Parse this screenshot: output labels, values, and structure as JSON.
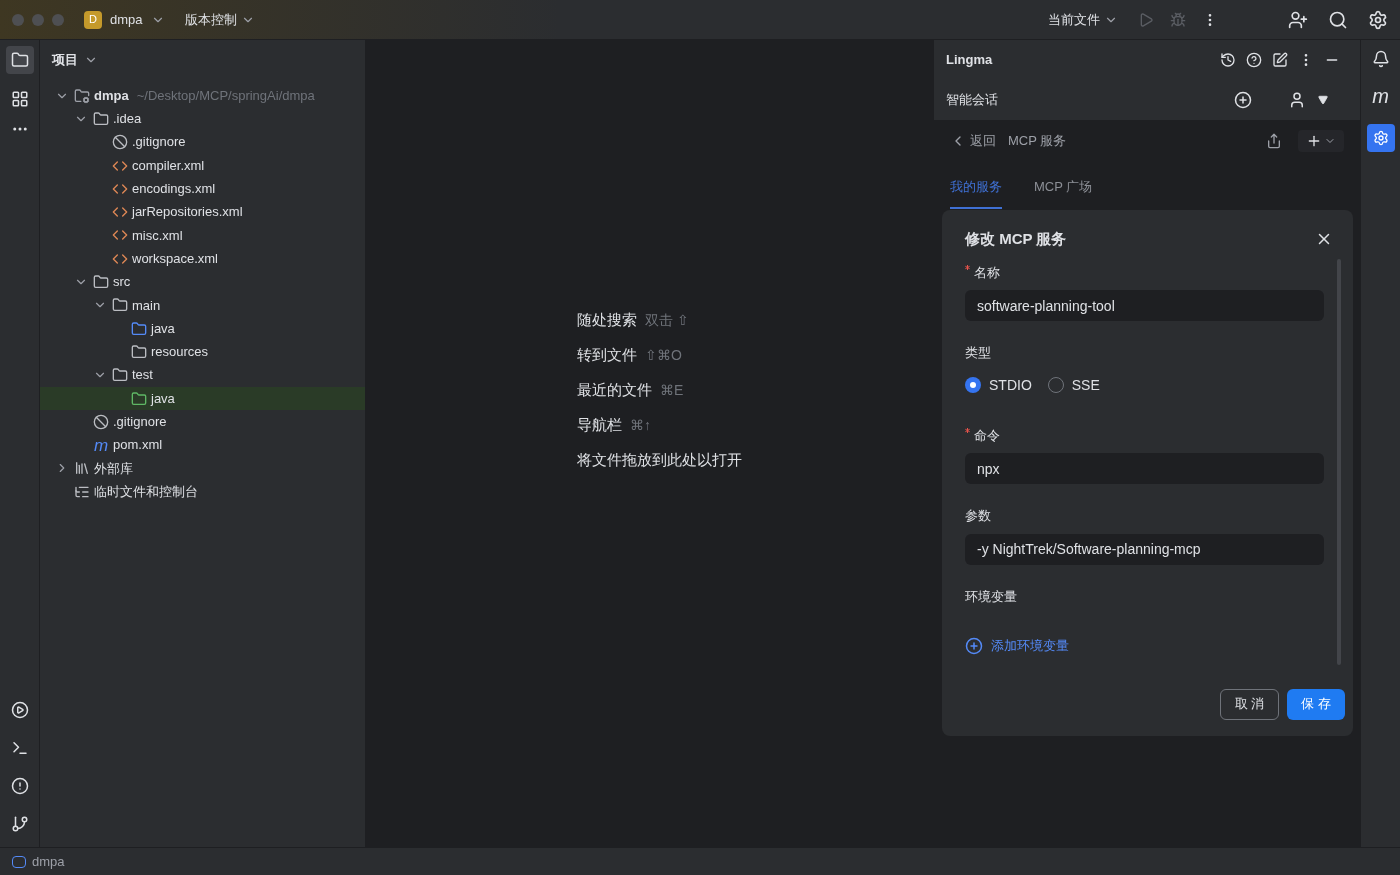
{
  "titlebar": {
    "project_badge": "D",
    "project": "dmpa",
    "vcs": "版本控制",
    "run_config": "当前文件"
  },
  "project_panel": {
    "title": "项目",
    "tree": [
      {
        "kind": "module",
        "name": "dmpa",
        "path": "~/Desktop/MCP/springAi/dmpa",
        "expanded": true,
        "selected": false,
        "children": [
          {
            "kind": "folder",
            "name": ".idea",
            "expanded": true,
            "selected": false,
            "children": [
              {
                "kind": "ignore",
                "name": ".gitignore",
                "selected": false
              },
              {
                "kind": "xml",
                "name": "compiler.xml",
                "selected": false
              },
              {
                "kind": "xml",
                "name": "encodings.xml",
                "selected": false
              },
              {
                "kind": "xml",
                "name": "jarRepositories.xml",
                "selected": false
              },
              {
                "kind": "xml",
                "name": "misc.xml",
                "selected": false
              },
              {
                "kind": "xml",
                "name": "workspace.xml",
                "selected": false
              }
            ]
          },
          {
            "kind": "folder",
            "name": "src",
            "expanded": true,
            "selected": false,
            "children": [
              {
                "kind": "folder",
                "name": "main",
                "expanded": true,
                "selected": false,
                "children": [
                  {
                    "kind": "source",
                    "name": "java",
                    "selected": false
                  },
                  {
                    "kind": "resources",
                    "name": "resources",
                    "selected": false
                  }
                ]
              },
              {
                "kind": "folder",
                "name": "test",
                "expanded": true,
                "selected": false,
                "children": [
                  {
                    "kind": "test",
                    "name": "java",
                    "selected": true
                  }
                ]
              }
            ]
          },
          {
            "kind": "ignore",
            "name": ".gitignore",
            "selected": false
          },
          {
            "kind": "maven",
            "icon_text": "m",
            "name": "pom.xml",
            "selected": false
          }
        ]
      },
      {
        "kind": "library",
        "name": "外部库",
        "expanded": false,
        "selected": false
      },
      {
        "kind": "scratch",
        "name": "临时文件和控制台",
        "selected": false
      }
    ]
  },
  "editor_hints": [
    {
      "label": "随处搜索",
      "shortcut": "双击 ⇧"
    },
    {
      "label": "转到文件",
      "shortcut": "⇧⌘O"
    },
    {
      "label": "最近的文件",
      "shortcut": "⌘E"
    },
    {
      "label": "导航栏",
      "shortcut": "⌘↑"
    },
    {
      "label": "将文件拖放到此处以打开"
    }
  ],
  "lingma": {
    "title": "Lingma",
    "session_title": "智能会话",
    "back": "返回",
    "page_title": "MCP 服务",
    "tabs": [
      {
        "label": "我的服务",
        "selected": true
      },
      {
        "label": "MCP 广场",
        "selected": false
      }
    ],
    "dialog": {
      "title": "修改 MCP 服务",
      "fields": [
        {
          "kind": "text",
          "label": "名称",
          "required": true,
          "value": "software-planning-tool"
        },
        {
          "kind": "radio",
          "label": "类型",
          "required": false,
          "options": [
            {
              "label": "STDIO",
              "selected": true
            },
            {
              "label": "SSE",
              "selected": false
            }
          ]
        },
        {
          "kind": "text",
          "label": "命令",
          "required": true,
          "value": "npx"
        },
        {
          "kind": "text",
          "label": "参数",
          "required": false,
          "value": "-y NightTrek/Software-planning-mcp"
        },
        {
          "kind": "env",
          "label": "环境变量",
          "required": false,
          "action": "添加环境变量"
        }
      ],
      "buttons": [
        {
          "label": "取 消",
          "kind": "secondary"
        },
        {
          "label": "保 存",
          "kind": "primary"
        }
      ]
    }
  },
  "right_strip": {
    "plugin_letter": "m"
  },
  "status_bar": {
    "project": "dmpa"
  }
}
